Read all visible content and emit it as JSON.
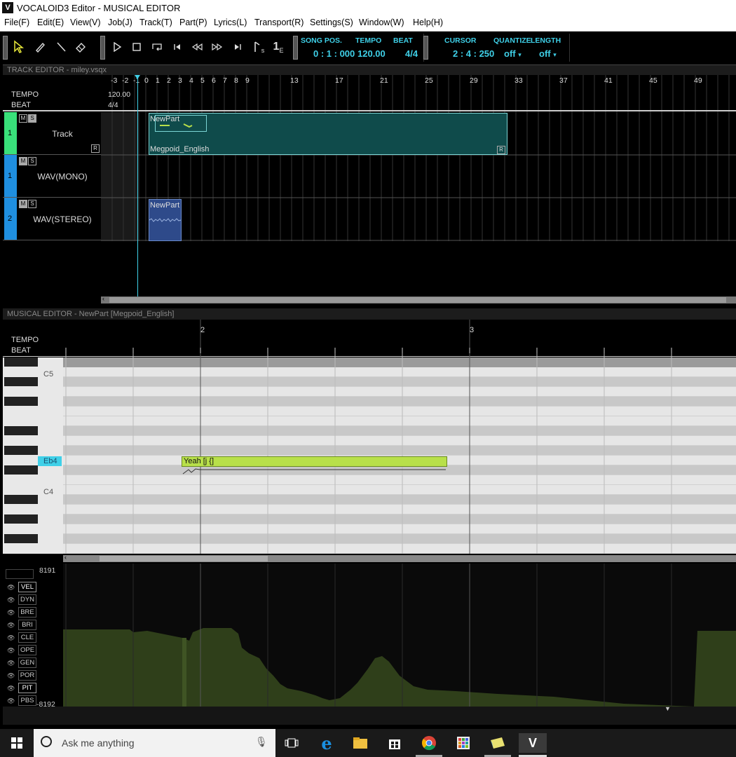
{
  "window": {
    "title": "VOCALOID3 Editor - MUSICAL EDITOR",
    "logo": "V"
  },
  "menu": [
    "File(F)",
    "Edit(E)",
    "View(V)",
    "Job(J)",
    "Track(T)",
    "Part(P)",
    "Lyrics(L)",
    "Transport(R)",
    "Settings(S)",
    "Window(W)",
    "Help(H)"
  ],
  "toolbar": {
    "tools": [
      "arrow-icon",
      "pencil-icon",
      "line-icon",
      "eraser-icon"
    ],
    "transport": [
      "play-icon",
      "stop-icon",
      "loop-icon",
      "go-start-icon",
      "rewind-icon",
      "fast-forward-icon",
      "go-end-icon",
      "start-marker-icon",
      "end-marker-icon"
    ],
    "start_marker_sub": "s",
    "end_marker_num": "1",
    "end_marker_sub": "E",
    "song_pos_label": "SONG POS.",
    "song_pos_value": "0 : 1 : 000",
    "tempo_label": "TEMPO",
    "tempo_value": "120.00",
    "beat_label": "BEAT",
    "beat_value": "4/4",
    "cursor_label": "CURSOR",
    "cursor_value": "2 : 4 : 250",
    "quantize_label": "QUANTIZE",
    "quantize_value": "off",
    "length_label": "LENGTH",
    "length_value": "off"
  },
  "track_editor": {
    "title": "TRACK EDITOR - miley.vsqx",
    "tempo_label": "TEMPO",
    "beat_label": "BEAT",
    "tempo_value": "120.00",
    "beat_value": "4/4",
    "ruler": [
      "-3",
      "-2",
      "-1",
      "0",
      "1",
      "2",
      "3",
      "4",
      "5",
      "6",
      "7",
      "8",
      "9",
      "13",
      "17",
      "21",
      "25",
      "29",
      "33",
      "37",
      "41",
      "45",
      "49"
    ],
    "tracks": [
      {
        "num": "1",
        "name": "Track",
        "m": "M",
        "s": "S",
        "color": "#39e07a",
        "r": "R"
      },
      {
        "num": "1",
        "name": "WAV(MONO)",
        "m": "M",
        "s": "S",
        "color": "#1f8fe0"
      },
      {
        "num": "2",
        "name": "WAV(STEREO)",
        "m": "M",
        "s": "S",
        "color": "#1f8fe0"
      }
    ],
    "part1": {
      "name": "NewPart",
      "singer": "Megpoid_English",
      "r": "R"
    },
    "part2": {
      "name": "NewPart"
    }
  },
  "musical_editor": {
    "title": "MUSICAL EDITOR - NewPart [Megpoid_English]",
    "tempo_label": "TEMPO",
    "beat_label": "BEAT",
    "measures": [
      "2",
      "3"
    ],
    "keys": {
      "c5": "C5",
      "eb4": "Eb4",
      "c4": "C4"
    },
    "note": {
      "lyric": "Yeah [j {]"
    },
    "ctrl_max": "8191",
    "ctrl_min": "-8192",
    "controls": [
      "VEL",
      "DYN",
      "BRE",
      "BRI",
      "CLE",
      "OPE",
      "GEN",
      "POR",
      "PIT",
      "PBS"
    ]
  },
  "taskbar": {
    "search_placeholder": "Ask me anything",
    "apps": [
      "windows-icon",
      "microphone-icon",
      "task-view-icon",
      "edge-icon",
      "file-explorer-icon",
      "store-icon",
      "chrome-icon",
      "apps-icon",
      "sticky-notes-icon",
      "vocaloid-icon"
    ],
    "vocaloid_label": "V"
  },
  "colors": {
    "accent": "#3fd0e8",
    "note": "#b8e04a",
    "part": "#0f4b4b",
    "wav_part": "#2e4a8a",
    "control_fill": "#2f3f1a"
  }
}
